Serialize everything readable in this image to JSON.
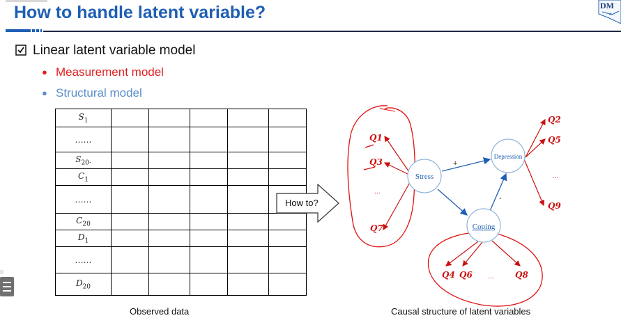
{
  "slide": {
    "title": "How to handle latent variable?",
    "logo_text": "DM"
  },
  "bullets": {
    "main": "Linear latent variable model",
    "sub": [
      {
        "text": "Measurement model",
        "color": "#e02020"
      },
      {
        "text": "Structural model",
        "color": "#5b8ec9"
      }
    ]
  },
  "table": {
    "rows": [
      "S1",
      "……",
      "S20·",
      "C1",
      "……",
      "C20",
      "D1",
      "……",
      "D20"
    ],
    "row_labels": [
      {
        "base": "S",
        "sub": "1"
      },
      {
        "base": "……",
        "sub": ""
      },
      {
        "base": "S",
        "sub": "20·"
      },
      {
        "base": "C",
        "sub": "1"
      },
      {
        "base": "……",
        "sub": ""
      },
      {
        "base": "C",
        "sub": "20"
      },
      {
        "base": "D",
        "sub": "1"
      },
      {
        "base": "……",
        "sub": ""
      },
      {
        "base": "D",
        "sub": "20"
      }
    ],
    "caption": "Observed data"
  },
  "arrow": {
    "label": "How to?"
  },
  "diagram": {
    "nodes": {
      "stress": "Stress",
      "depression": "Depression",
      "coping": "Coping"
    },
    "edge_signs": {
      "stress_depression": "+",
      "coping_depression": "-"
    },
    "indicators": {
      "stress": [
        "Q1",
        "Q3",
        "...",
        "Q7"
      ],
      "depression": [
        "Q2",
        "Q5",
        "...",
        "Q9"
      ],
      "coping": [
        "Q4",
        "Q6",
        "...",
        "Q8"
      ]
    },
    "caption": "Causal structure of latent variables",
    "colors": {
      "node": "#1f5fb4",
      "indicator": "#cc1111",
      "annotation": "#e01010"
    }
  },
  "icons": [
    "checkbox-checked-icon",
    "menu-icon",
    "logo-icon",
    "block-arrow-icon"
  ]
}
